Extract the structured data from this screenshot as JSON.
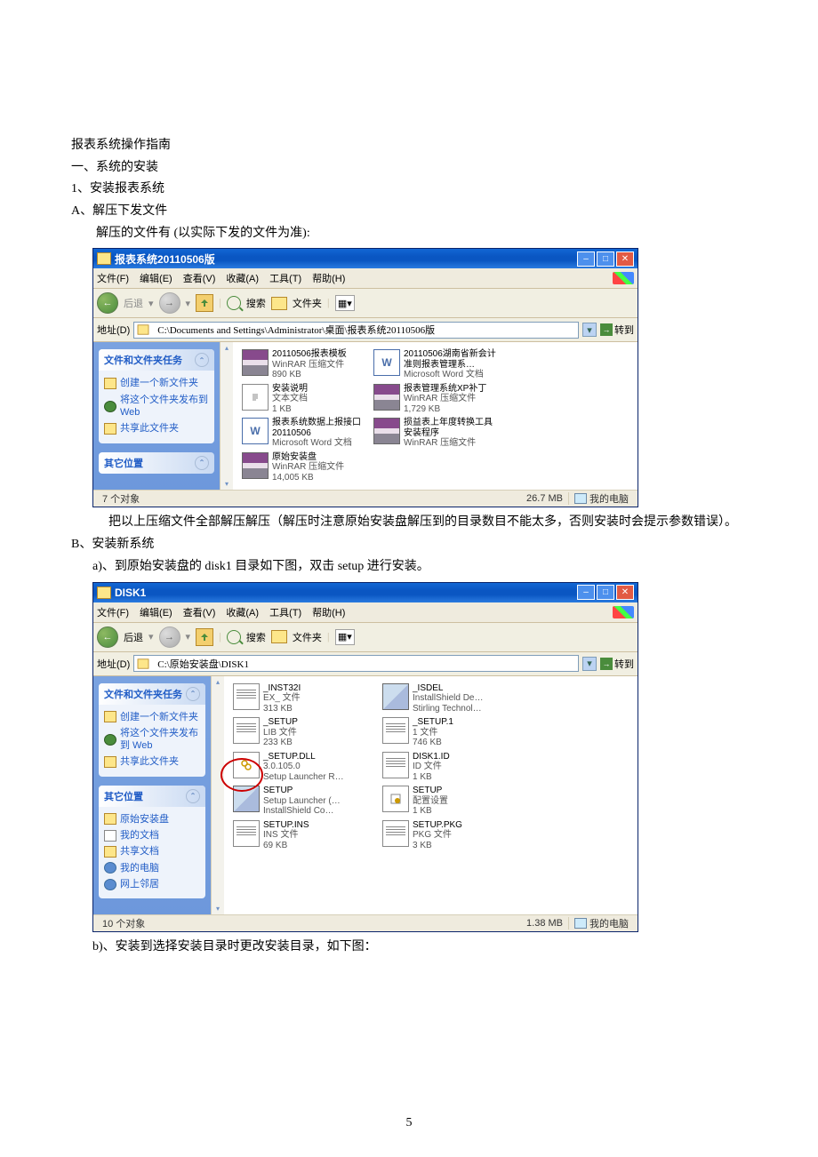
{
  "doc": {
    "title": "报表系统操作指南",
    "h1": "一、系统的安装",
    "h1_1": "1、安装报表系统",
    "lineA": "A、解压下发文件",
    "lineA2": "解压的文件有 (以实际下发的文件为准):",
    "paraA": "把以上压缩文件全部解压解压（解压时注意原始安装盘解压到的目录数目不能太多，否则安装时会提示参数错误）。",
    "lineB": "B、安装新系统",
    "lineB1": "a)、到原始安装盘的 disk1 目录如下图，双击 setup 进行安装。",
    "lineB2": "b)、安装到选择安装目录时更改安装目录，如下图：",
    "page_number": "5"
  },
  "menus": {
    "file": "文件(F)",
    "edit": "编辑(E)",
    "view": "查看(V)",
    "fav": "收藏(A)",
    "tools": "工具(T)",
    "help": "帮助(H)"
  },
  "toolbar": {
    "back": "后退",
    "search": "搜索",
    "folders": "文件夹"
  },
  "addr": {
    "label": "地址(D)",
    "go": "转到"
  },
  "sidebar": {
    "panel1_title": "文件和文件夹任务",
    "new_folder": "创建一个新文件夹",
    "publish": "将这个文件夹发布到 Web",
    "share": "共享此文件夹",
    "panel2_title": "其它位置",
    "loc1": "原始安装盘",
    "loc2": "我的文档",
    "loc3": "共享文档",
    "loc4": "我的电脑",
    "loc5": "网上邻居"
  },
  "win1": {
    "title": "报表系统20110506版",
    "path": "C:\\Documents and Settings\\Administrator\\桌面\\报表系统20110506版",
    "files": [
      {
        "name": "20110506报表模板",
        "l2": "WinRAR 压缩文件",
        "l3": "890 KB",
        "type": "rar"
      },
      {
        "name": "20110506湖南省新会计准则报表管理系…",
        "l2": "Microsoft Word 文档",
        "l3": "",
        "type": "word"
      },
      {
        "name": "安装说明",
        "l2": "文本文档",
        "l3": "1 KB",
        "type": "txt"
      },
      {
        "name": "报表管理系统XP补丁",
        "l2": "WinRAR 压缩文件",
        "l3": "1,729 KB",
        "type": "rar"
      },
      {
        "name": "报表系统数据上报接口20110506",
        "l2": "Microsoft Word 文档",
        "l3": "",
        "type": "word"
      },
      {
        "name": "损益表上年度转换工具安装程序",
        "l2": "WinRAR 压缩文件",
        "l3": "",
        "type": "rar"
      },
      {
        "name": "原始安装盘",
        "l2": "WinRAR 压缩文件",
        "l3": "14,005 KB",
        "type": "rar"
      }
    ],
    "status_left": "7 个对象",
    "status_size": "26.7 MB",
    "status_right": "我的电脑"
  },
  "win2": {
    "title": "DISK1",
    "path": "C:\\原始安装盘\\DISK1",
    "files": [
      {
        "name": "_INST32I",
        "l2": "EX_ 文件",
        "l3": "313 KB",
        "type": "gen"
      },
      {
        "name": "_ISDEL",
        "l2": "InstallShield De…",
        "l3": "Stirling Technol…",
        "type": "exe"
      },
      {
        "name": "_SETUP",
        "l2": "LIB 文件",
        "l3": "233 KB",
        "type": "gen"
      },
      {
        "name": "_SETUP.1",
        "l2": "1 文件",
        "l3": "746 KB",
        "type": "gen"
      },
      {
        "name": "_SETUP.DLL",
        "l2": "3.0.105.0",
        "l3": "Setup Launcher R…",
        "type": "dll"
      },
      {
        "name": "DISK1.ID",
        "l2": "ID 文件",
        "l3": "1 KB",
        "type": "gen"
      },
      {
        "name": "SETUP",
        "l2": "Setup Launcher (…",
        "l3": "InstallShield Co…",
        "type": "exe"
      },
      {
        "name": "SETUP",
        "l2": "配置设置",
        "l3": "1 KB",
        "type": "cfg"
      },
      {
        "name": "SETUP.INS",
        "l2": "INS 文件",
        "l3": "69 KB",
        "type": "gen"
      },
      {
        "name": "SETUP.PKG",
        "l2": "PKG 文件",
        "l3": "3 KB",
        "type": "gen"
      }
    ],
    "status_left": "10 个对象",
    "status_size": "1.38 MB",
    "status_right": "我的电脑"
  }
}
